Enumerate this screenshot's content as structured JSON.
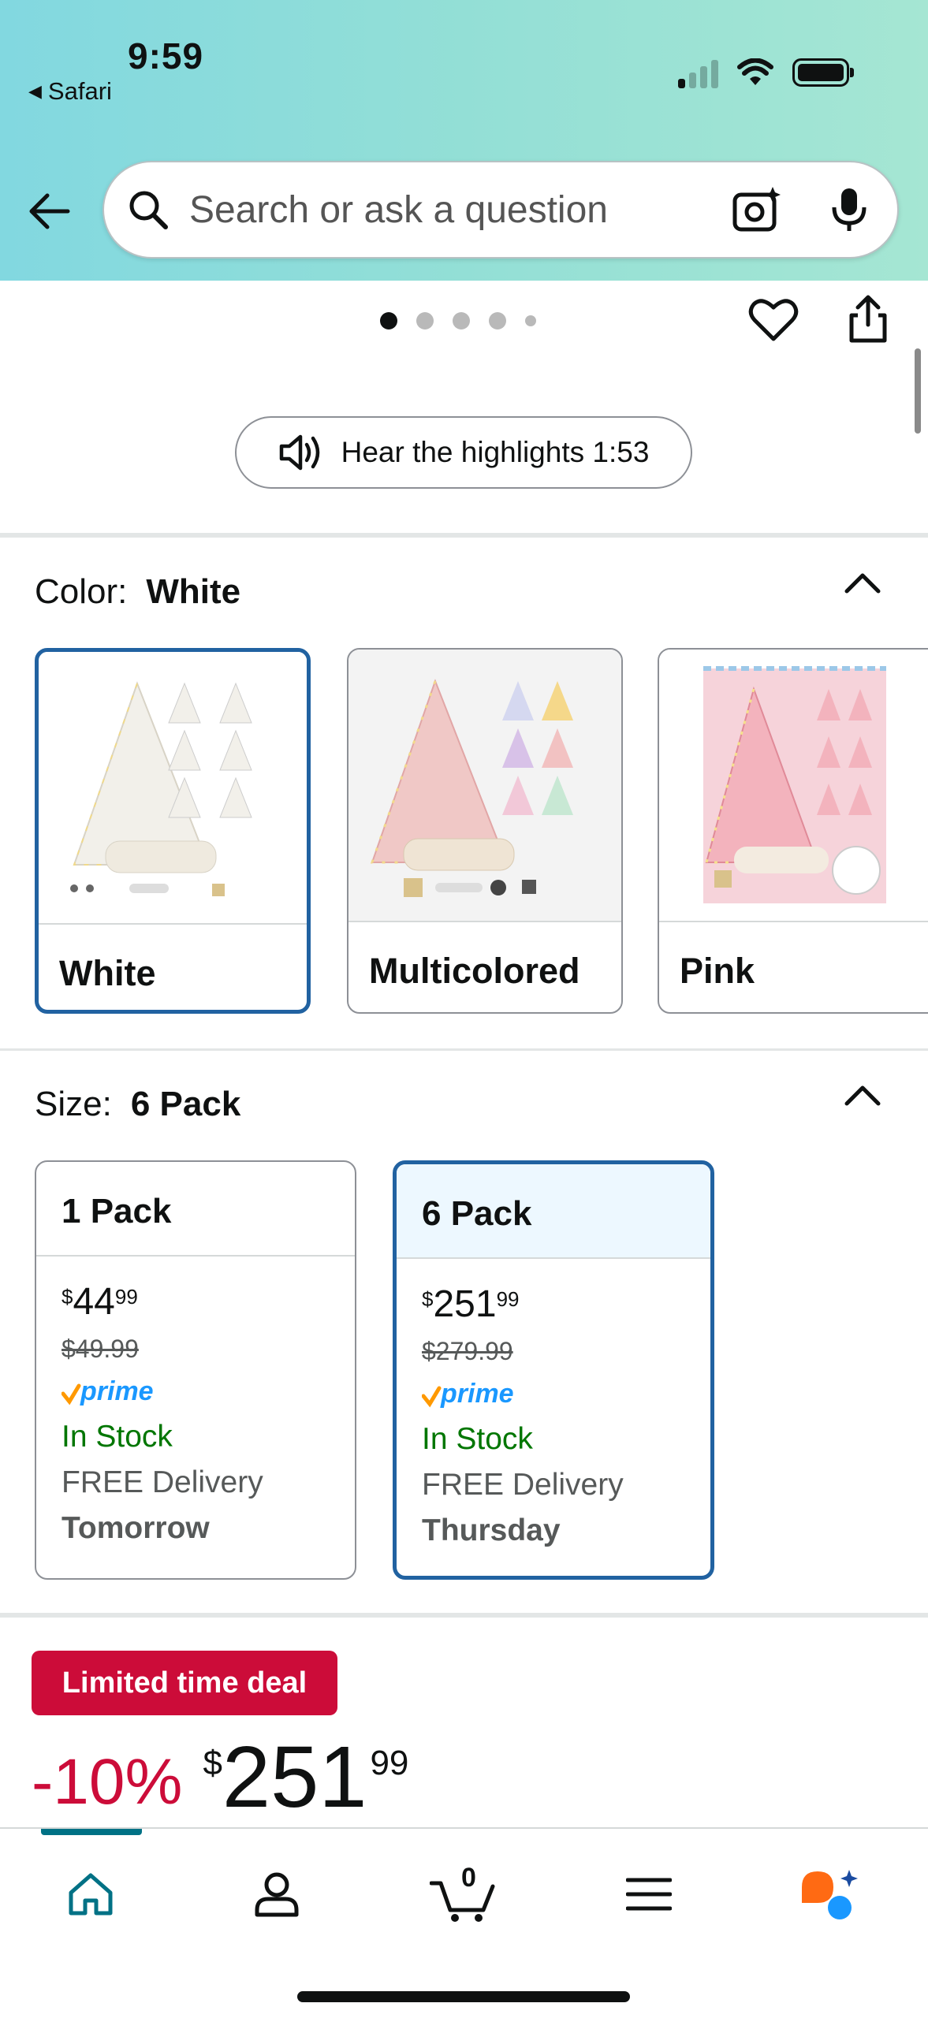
{
  "status_bar": {
    "time": "9:59",
    "back_app": "Safari"
  },
  "search": {
    "placeholder": "Search or ask a question"
  },
  "gallery": {
    "dot_count": 5,
    "active_dot": 0
  },
  "audio": {
    "label": "Hear the highlights 1:53"
  },
  "color": {
    "label": "Color:",
    "selected": "White",
    "options": [
      {
        "name": "White",
        "selected": true
      },
      {
        "name": "Multicolored",
        "selected": false
      },
      {
        "name": "Pink",
        "selected": false
      }
    ]
  },
  "size": {
    "label": "Size:",
    "selected": "6 Pack",
    "options": [
      {
        "name": "1 Pack",
        "selected": false,
        "price_symbol": "$",
        "price_whole": "44",
        "price_cents": "99",
        "list_price": "$49.99",
        "prime": "prime",
        "stock": "In Stock",
        "delivery": "FREE Delivery",
        "delivery_day": "Tomorrow"
      },
      {
        "name": "6 Pack",
        "selected": true,
        "price_symbol": "$",
        "price_whole": "251",
        "price_cents": "99",
        "list_price": "$279.99",
        "prime": "prime",
        "stock": "In Stock",
        "delivery": "FREE Delivery",
        "delivery_day": "Thursday"
      }
    ]
  },
  "deal": {
    "badge": "Limited time deal",
    "discount": "-10%",
    "price_symbol": "$",
    "price_whole": "251",
    "price_cents": "99"
  },
  "bottom_nav": {
    "cart_count": "0",
    "tabs": [
      "home-icon",
      "account-icon",
      "cart-icon",
      "menu-icon",
      "rufus-icon"
    ]
  },
  "colors": {
    "accent_teal": "#007185",
    "selected_border": "#2162a1",
    "deal_red": "#cc0c39",
    "stock_green": "#007600",
    "prime_blue": "#1a98ff"
  }
}
